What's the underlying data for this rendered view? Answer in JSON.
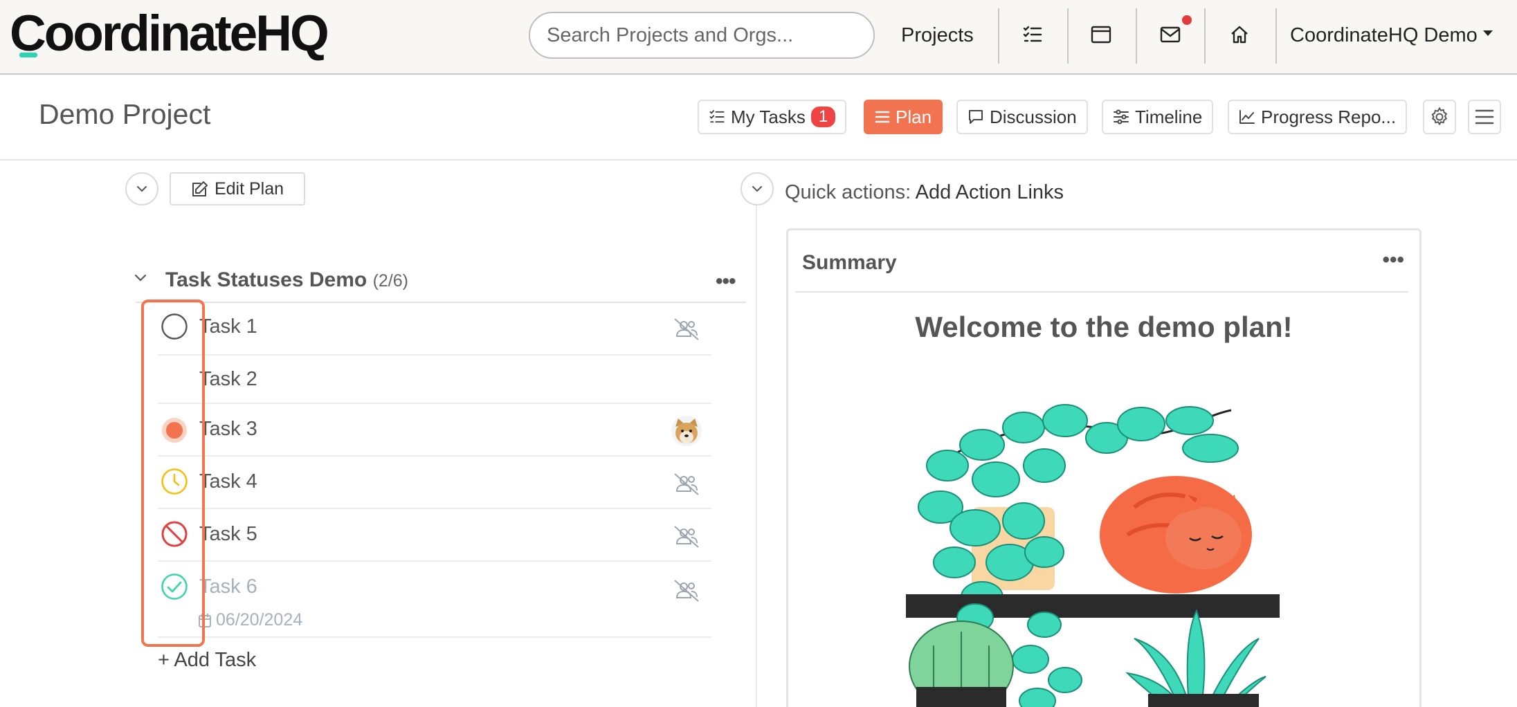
{
  "nav": {
    "logo": "CoordinateHQ",
    "search_placeholder": "Search Projects and Orgs...",
    "projects_label": "Projects",
    "user_label": "CoordinateHQ Demo"
  },
  "project": {
    "title": "Demo Project",
    "tabs": [
      {
        "label": "My Tasks",
        "badge": "1"
      },
      {
        "label": "Plan"
      },
      {
        "label": "Discussion"
      },
      {
        "label": "Timeline"
      },
      {
        "label": "Progress Repo..."
      }
    ]
  },
  "plan": {
    "edit_label": "Edit Plan",
    "group": {
      "title": "Task Statuses Demo",
      "count": "(2/6)"
    },
    "tasks": [
      {
        "name": "Task 1",
        "status": "not-started",
        "assignee": "unassigned"
      },
      {
        "name": "Task 2",
        "status": "none",
        "assignee": "none"
      },
      {
        "name": "Task 3",
        "status": "in-progress",
        "assignee": "dog-avatar"
      },
      {
        "name": "Task 4",
        "status": "waiting",
        "assignee": "unassigned"
      },
      {
        "name": "Task 5",
        "status": "blocked",
        "assignee": "unassigned"
      },
      {
        "name": "Task 6",
        "status": "complete",
        "assignee": "unassigned",
        "date": "06/20/2024"
      }
    ],
    "add_task_label": "+ Add Task"
  },
  "quick_actions": {
    "prefix": "Quick actions:",
    "link": "Add Action Links"
  },
  "summary": {
    "title": "Summary",
    "welcome": "Welcome to the demo plan!"
  },
  "colors": {
    "accent": "#f2734f",
    "teal": "#2ed3b0",
    "badge": "#ef4444",
    "waiting": "#f2c10f",
    "blocked": "#e53e3e",
    "complete": "#3fd4ad"
  }
}
